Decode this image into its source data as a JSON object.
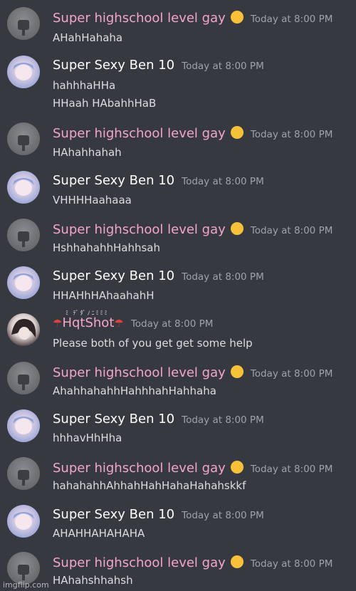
{
  "users": {
    "gay_name": "Super highschool level gay",
    "ben_name": "Super Sexy Ben 10",
    "hot_name": "HqtShot",
    "hot_deco": "ﾐ ﾃﾞﾀﾟﾉﾆﾐﾐﾐ"
  },
  "timestamp": "Today at 8:00 PM",
  "messages": [
    {
      "user": "gay",
      "lines": [
        "AHahHahaha"
      ]
    },
    {
      "user": "ben",
      "lines": [
        "hahhhaHHa",
        "HHaah HAbahhHaB"
      ]
    },
    {
      "user": "gay",
      "lines": [
        "HAhahhahah"
      ]
    },
    {
      "user": "ben",
      "lines": [
        "VHHHHaahaaa"
      ]
    },
    {
      "user": "gay",
      "lines": [
        "HshhahahhHahhsah"
      ]
    },
    {
      "user": "ben",
      "lines": [
        "HHAHhHAhaahahH"
      ]
    },
    {
      "user": "hot",
      "lines": [
        "Please both of you get get some help"
      ]
    },
    {
      "user": "gay",
      "lines": [
        "AhahhahahhHahhhahHahhaha"
      ]
    },
    {
      "user": "ben",
      "lines": [
        "hhhavHhHha"
      ]
    },
    {
      "user": "gay",
      "lines": [
        "hahahahhAhhahHahHahaHahahskkf"
      ]
    },
    {
      "user": "ben",
      "lines": [
        "AHAHHAHAHAHA"
      ]
    },
    {
      "user": "gay",
      "lines": [
        "HAhahshhahsh"
      ]
    }
  ],
  "watermark": "imgflip.com",
  "colors": {
    "background": "#36393f",
    "pink_name": "#f4a6c8",
    "white_name": "#ffffff",
    "timestamp": "#9fa3a8",
    "text": "#dcddde"
  },
  "icons": {
    "gay_emoji": "heart-eyes-emoji-icon",
    "hot_umbrella": "umbrella-icon"
  }
}
